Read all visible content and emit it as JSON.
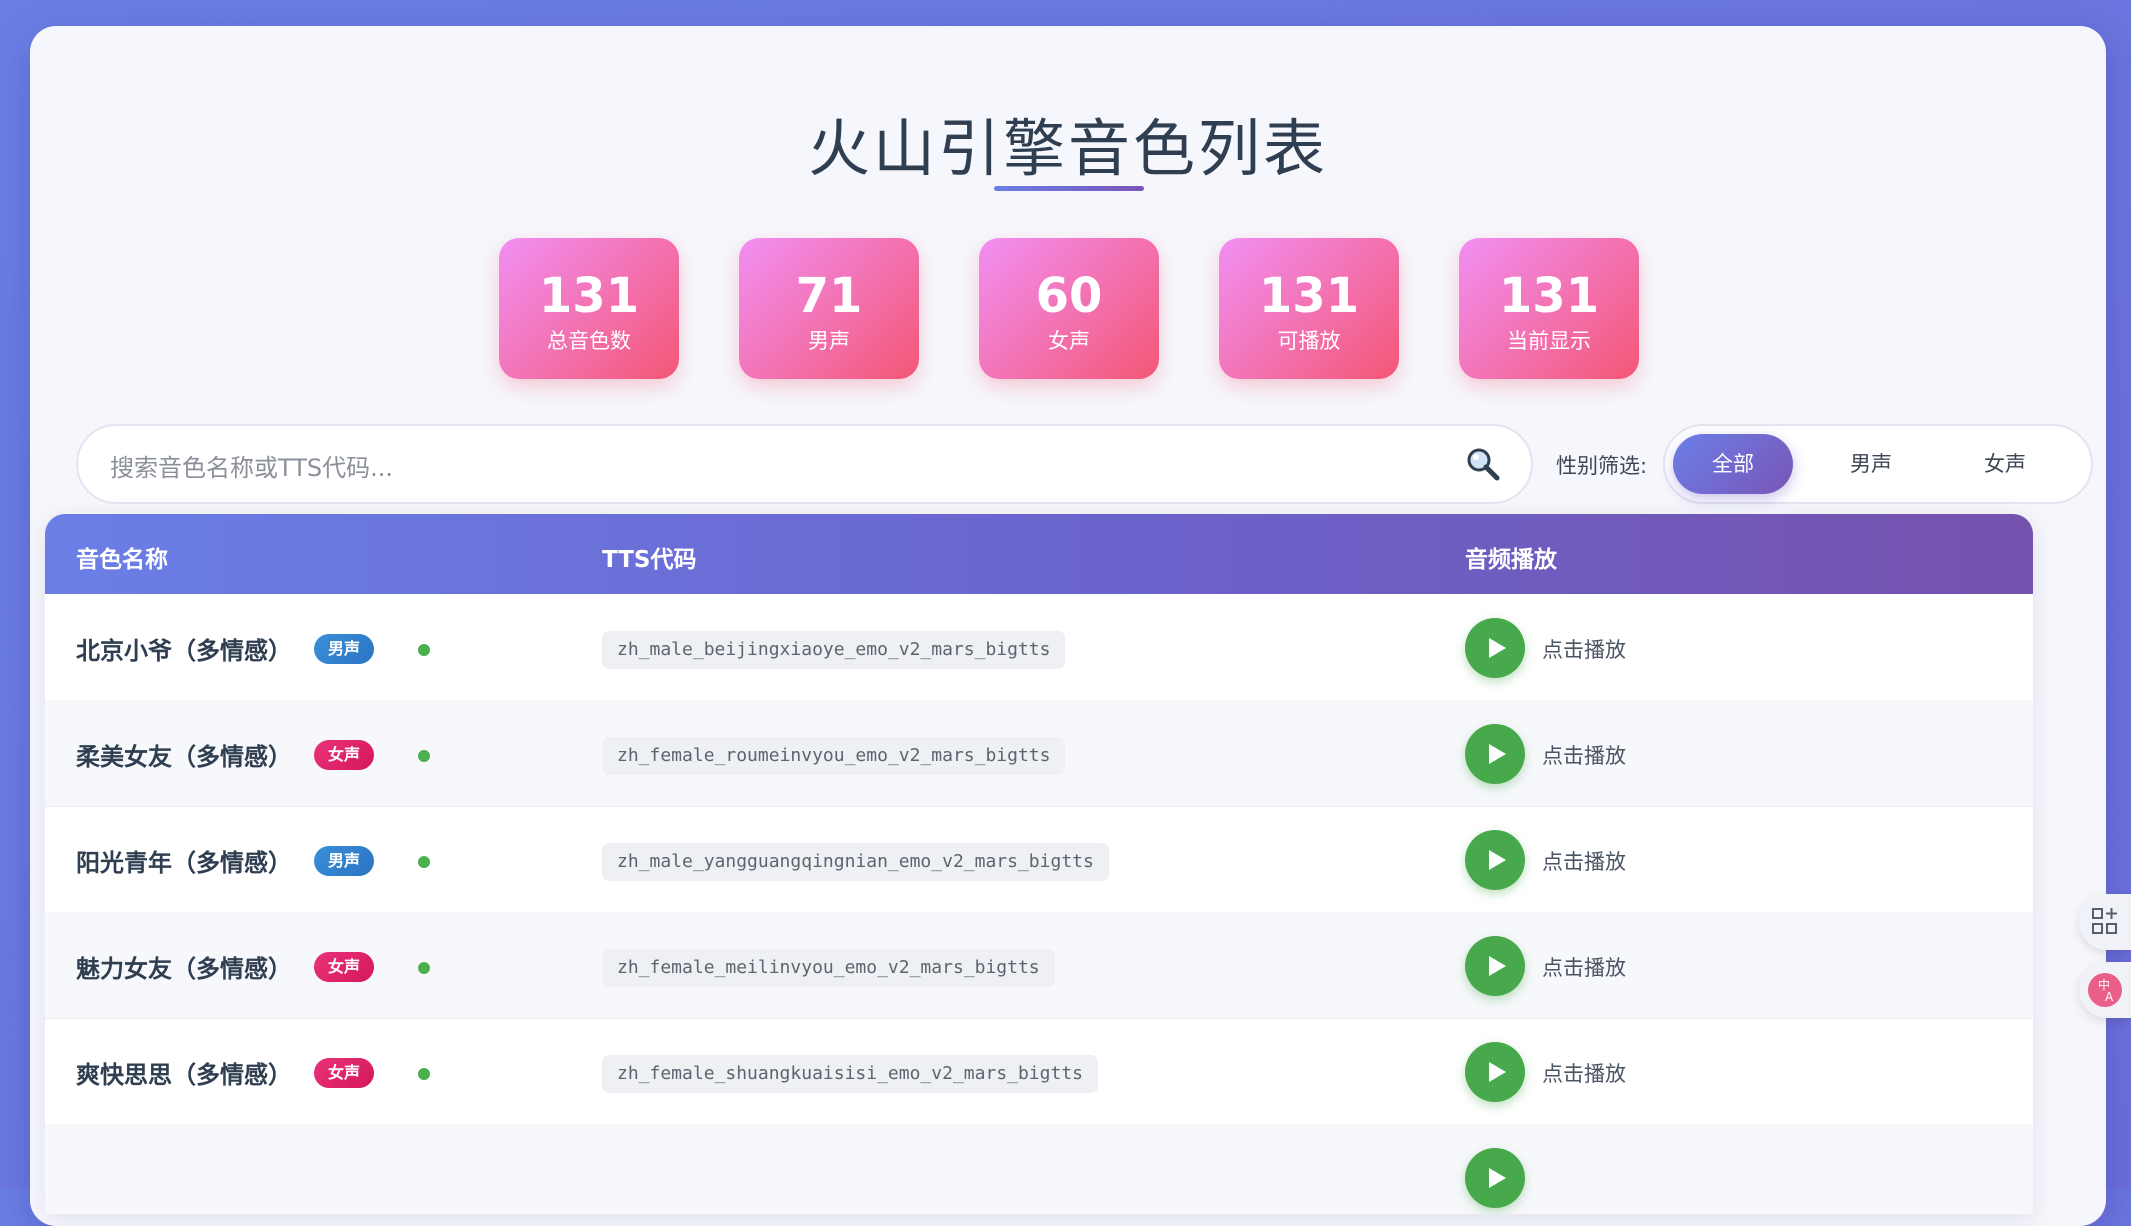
{
  "page": {
    "title": "火山引擎音色列表"
  },
  "stats": [
    {
      "value": "131",
      "label": "总音色数"
    },
    {
      "value": "71",
      "label": "男声"
    },
    {
      "value": "60",
      "label": "女声"
    },
    {
      "value": "131",
      "label": "可播放"
    },
    {
      "value": "131",
      "label": "当前显示"
    }
  ],
  "search": {
    "placeholder": "搜索音色名称或TTS代码..."
  },
  "filter": {
    "label": "性别筛选:",
    "options": [
      "全部",
      "男声",
      "女声"
    ],
    "selected": "全部"
  },
  "table": {
    "headers": [
      "音色名称",
      "TTS代码",
      "音频播放"
    ],
    "rows": [
      {
        "name": "北京小爷（多情感）",
        "gender": "男声",
        "code": "zh_male_beijingxiaoye_emo_v2_mars_bigtts",
        "play_label": "点击播放"
      },
      {
        "name": "柔美女友（多情感）",
        "gender": "女声",
        "code": "zh_female_roumeinvyou_emo_v2_mars_bigtts",
        "play_label": "点击播放"
      },
      {
        "name": "阳光青年（多情感）",
        "gender": "男声",
        "code": "zh_male_yangguangqingnian_emo_v2_mars_bigtts",
        "play_label": "点击播放"
      },
      {
        "name": "魅力女友（多情感）",
        "gender": "女声",
        "code": "zh_female_meilinvyou_emo_v2_mars_bigtts",
        "play_label": "点击播放"
      },
      {
        "name": "爽快思思（多情感）",
        "gender": "女声",
        "code": "zh_female_shuangkuaisisi_emo_v2_mars_bigtts",
        "play_label": "点击播放"
      }
    ]
  },
  "colors": {
    "accent": "#6a7fe6",
    "accent_end": "#7552ad",
    "stat_start": "#f18ff3",
    "stat_end": "#f45775",
    "male_badge": "#2b74c2",
    "female_badge": "#d6175b",
    "play_green": "#47a84c"
  },
  "icons": {
    "search": "magnifier-icon",
    "play": "play-icon",
    "side_grid": "grid-add-icon",
    "side_translate": "translate-icon"
  }
}
